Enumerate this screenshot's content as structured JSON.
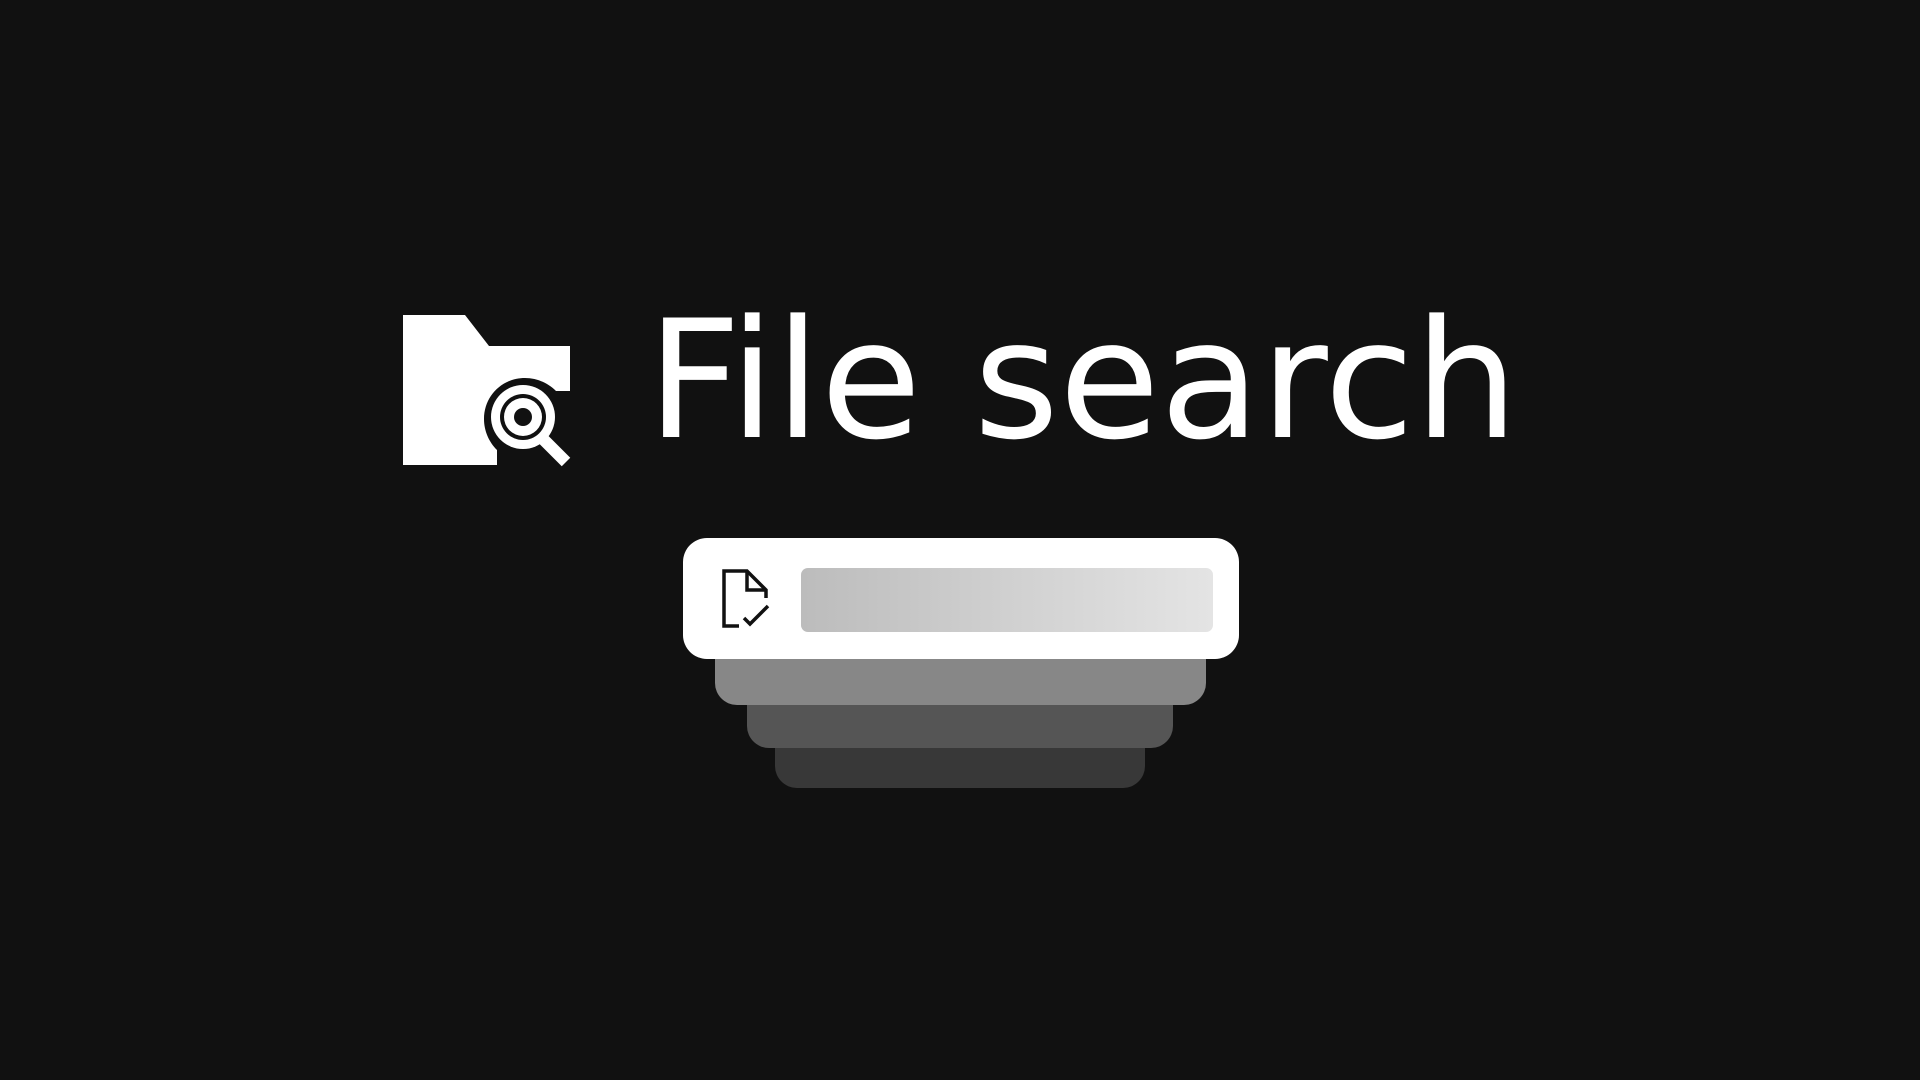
{
  "hero": {
    "title": "File search",
    "icon": "folder-search-icon"
  },
  "search": {
    "icon": "document-check-icon",
    "value": "",
    "placeholder": ""
  },
  "colors": {
    "background": "#111111",
    "foreground": "#ffffff",
    "card": "#ffffff",
    "stack_layer_1": "#878787",
    "stack_layer_2": "#555555",
    "stack_layer_3": "#383838"
  }
}
